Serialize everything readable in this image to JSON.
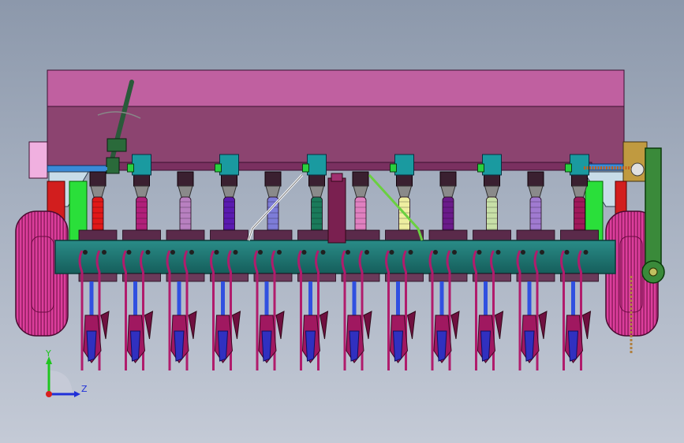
{
  "viewport": {
    "description_colors": {
      "hopper_top": "#c060a0",
      "hopper_front": "#8c4470",
      "beam": "#1e7a76",
      "wheel": "#cc2f8c",
      "frame_red": "#d21e1e",
      "frame_green": "#2adf3a",
      "opener": "#b01c6c"
    }
  },
  "axes": {
    "y_label": "Y",
    "z_label": "Z",
    "y_color": "#1fc51f",
    "z_color": "#1f2fd8",
    "origin_color": "#d81f1f"
  },
  "tubes": [
    {
      "color": "#e01818"
    },
    {
      "color": "#b0207a"
    },
    {
      "color": "#b880c0"
    },
    {
      "color": "#5a1ab0"
    },
    {
      "color": "#7d7cd8"
    },
    {
      "color": "#1a7a5a"
    },
    {
      "color": "#e080c0"
    },
    {
      "color": "#eeeea0"
    },
    {
      "color": "#6a1a8a"
    },
    {
      "color": "#c8e0a8"
    },
    {
      "color": "#a07ad0"
    },
    {
      "color": "#a0185a"
    }
  ]
}
